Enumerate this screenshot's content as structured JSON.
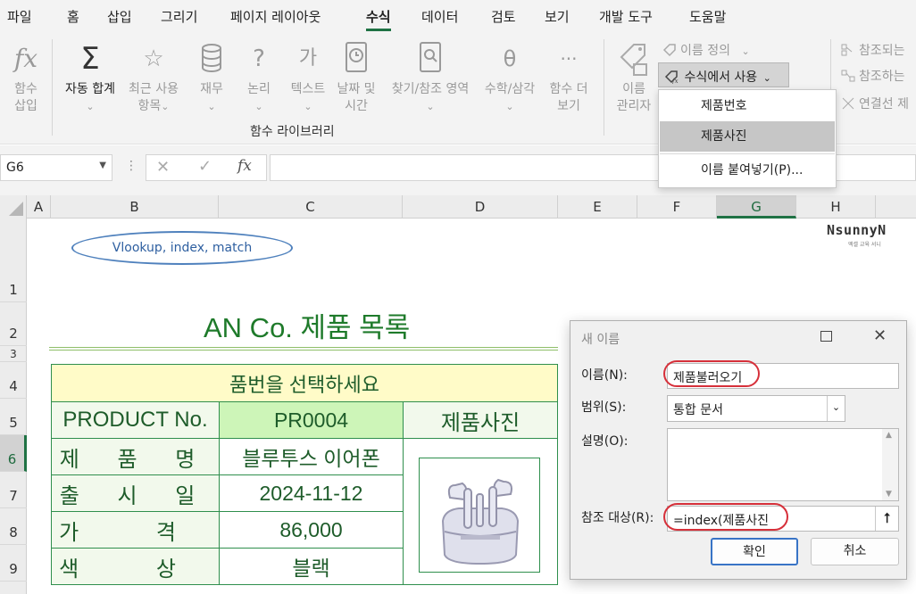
{
  "menu": {
    "tabs": [
      "파일",
      "홈",
      "삽입",
      "그리기",
      "페이지 레이아웃",
      "수식",
      "데이터",
      "검토",
      "보기",
      "개발 도구",
      "도움말"
    ],
    "active_tab": "수식"
  },
  "ribbon": {
    "insert_function": "함수\n삽입",
    "autosum": "자동 합계",
    "recent": "최근 사용\n항목",
    "financial": "재무",
    "logical": "논리",
    "text": "텍스트",
    "datetime": "날짜 및\n시간",
    "lookup": "찾기/참조 영역",
    "math": "수학/삼각",
    "more": "함수 더\n보기",
    "group_label": "함수 라이브러리",
    "name_manager": "이름\n관리자",
    "define_name": "이름 정의",
    "use_in_formula": "수식에서 사용",
    "trace_precedents": "참조되는",
    "trace_dependents": "참조하는",
    "remove_arrows": "연결선 제",
    "glyphs": {
      "fx": "fx",
      "sigma": "Σ",
      "star": "☆",
      "question": "?",
      "ga": "가",
      "theta": "θ",
      "dots": "···",
      "chevron": "⌄"
    }
  },
  "dropdown": {
    "items": [
      "제품번호",
      "제품사진",
      "이름 붙여넣기(P)..."
    ],
    "selected_index": 1
  },
  "formula_bar": {
    "name_box": "G6",
    "dots": "⋮",
    "cancel": "✕",
    "enter": "✓",
    "fx": "fx"
  },
  "columns": [
    "A",
    "B",
    "C",
    "D",
    "E",
    "F",
    "G",
    "H"
  ],
  "selected_column": "G",
  "rows": [
    "1",
    "2",
    "3",
    "4",
    "5",
    "6",
    "7",
    "8",
    "9"
  ],
  "selected_row": "6",
  "sheet": {
    "bubble": "Vlookup, index, match",
    "logo": "NsunnyN",
    "logo_sub": "엑셀 교육 서니",
    "title": "AN Co. 제품 목록",
    "header_prompt": "품번을 선택하세요",
    "product_no_label": "PRODUCT No.",
    "product_no_value": "PR0004",
    "photo_label": "제품사진",
    "name_label": "제 품 명",
    "name_value": "블루투스 이어폰",
    "release_label": "출 시 일",
    "release_value": "2024-11-12",
    "price_label": "가 격",
    "price_value": "86,000",
    "color_label": "색 상",
    "color_value": "블랙"
  },
  "colors": {
    "green_dark": "#1e5c2a",
    "yellow_fill": "#fffbc8",
    "green_fill": "#cdf5b8",
    "light_fill": "#f2f9ec",
    "excel_green": "#1f7244",
    "red_annotation": "#d6303a"
  },
  "dialog": {
    "title": "새 이름",
    "name_label": "이름(N):",
    "name_value": "제품불러오기",
    "scope_label": "범위(S):",
    "scope_value": "통합 문서",
    "comment_label": "설명(O):",
    "comment_value": "",
    "refers_label": "참조 대상(R):",
    "refers_value": "=index(제품사진",
    "ok": "확인",
    "cancel": "취소",
    "max_icon": "maximize-icon",
    "close": "✕",
    "upload": "⭡"
  }
}
